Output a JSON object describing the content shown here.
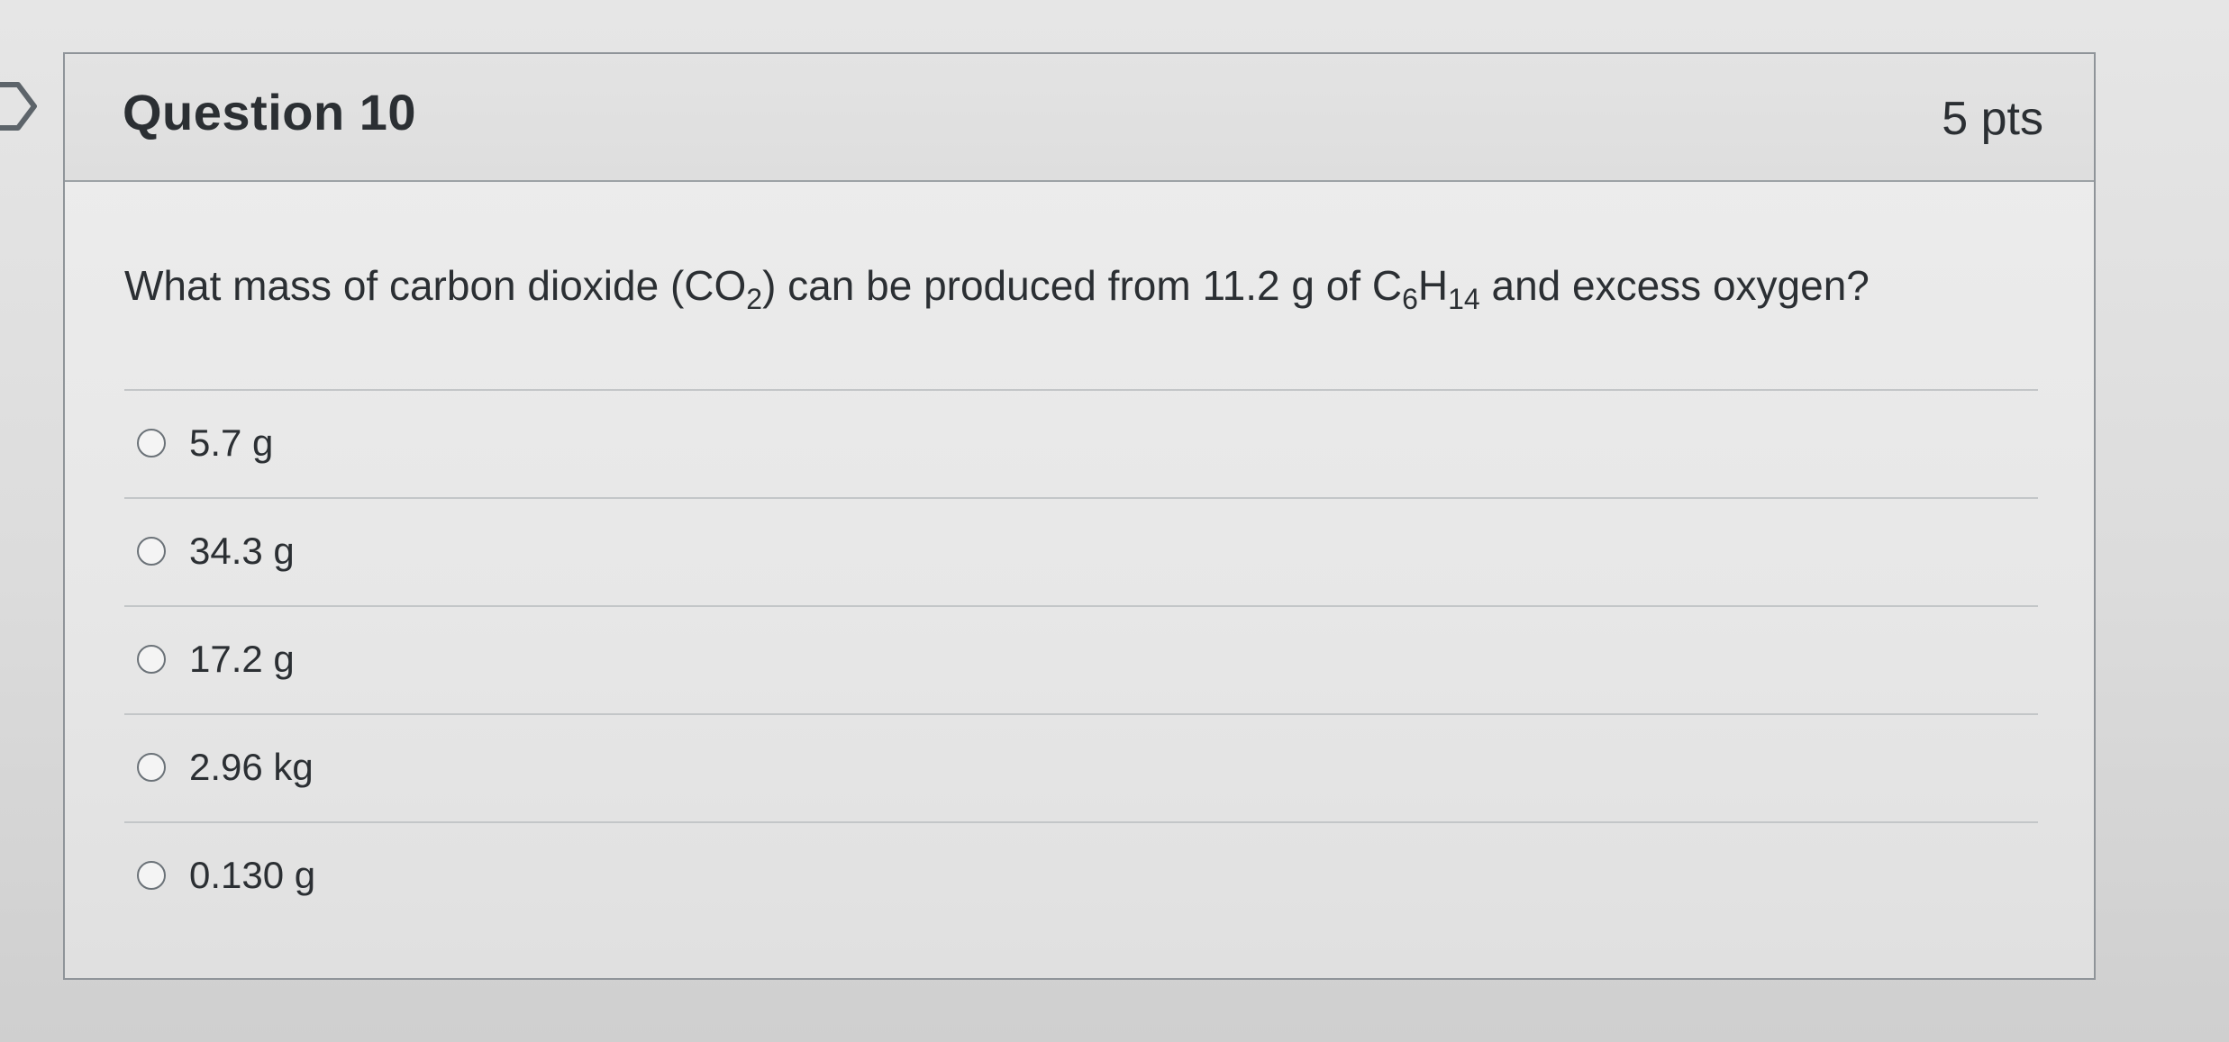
{
  "question": {
    "title": "Question 10",
    "points": "5 pts",
    "text_parts": {
      "p1": "What mass of carbon dioxide (CO",
      "s1": "2",
      "p2": ") can be produced from 11.2 g of C",
      "s2": "6",
      "p3": "H",
      "s3": "14",
      "p4": " and excess oxygen?"
    }
  },
  "answers": [
    {
      "label": "5.7 g",
      "selected": false
    },
    {
      "label": "34.3 g",
      "selected": false
    },
    {
      "label": "17.2 g",
      "selected": false
    },
    {
      "label": "2.96 kg",
      "selected": false
    },
    {
      "label": "0.130 g",
      "selected": false
    }
  ],
  "colors": {
    "border": "#8f9499",
    "text": "#2b2f33",
    "radio_border": "#6b7278"
  },
  "icons": {
    "flag": "flag-marker-icon",
    "radio": "radio-unchecked-icon"
  }
}
